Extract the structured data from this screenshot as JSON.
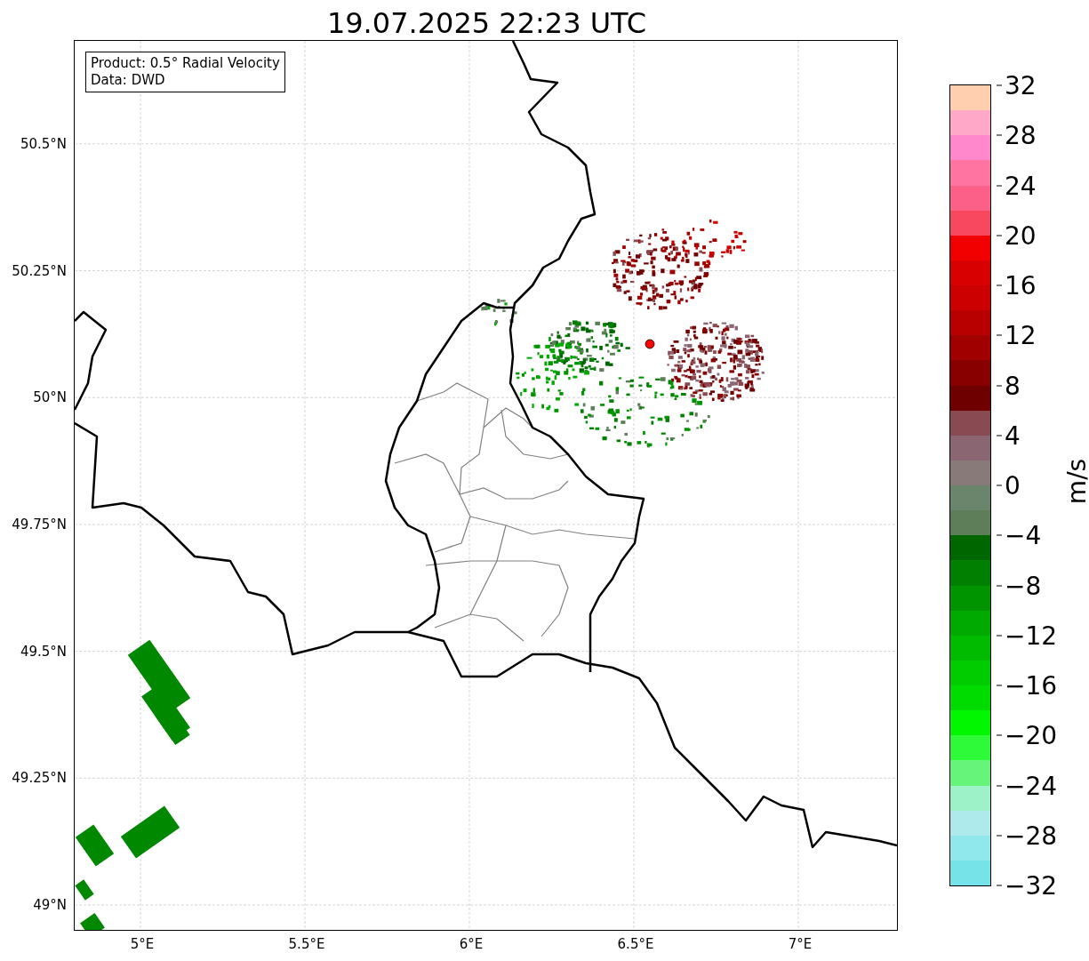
{
  "title": "19.07.2025 22:23 UTC",
  "map": {
    "info": [
      "Product: 0.5° Radial Velocity",
      "Data: DWD"
    ],
    "lon_ticks": [
      "5°E",
      "5.5°E",
      "6°E",
      "6.5°E",
      "7°E"
    ],
    "lat_ticks": [
      "50.5°N",
      "50.25°N",
      "50°N",
      "49.75°N",
      "49.5°N",
      "49.25°N",
      "49°N"
    ]
  },
  "colorbar": {
    "label": "m/s",
    "ticks": [
      "32",
      "28",
      "24",
      "20",
      "16",
      "12",
      "8",
      "4",
      "0",
      "−4",
      "−8",
      "−12",
      "−16",
      "−20",
      "−24",
      "−28",
      "−32"
    ],
    "bins": [
      {
        "color": "#76e3e8"
      },
      {
        "color": "#90e8ec"
      },
      {
        "color": "#aeeaec"
      },
      {
        "color": "#9df2c8"
      },
      {
        "color": "#66f57a"
      },
      {
        "color": "#2ffa3a"
      },
      {
        "color": "#00f700"
      },
      {
        "color": "#00dc00"
      },
      {
        "color": "#00cc00"
      },
      {
        "color": "#00bb00"
      },
      {
        "color": "#00aa00"
      },
      {
        "color": "#009400"
      },
      {
        "color": "#007f00"
      },
      {
        "color": "#006600"
      },
      {
        "color": "#5e7e5a"
      },
      {
        "color": "#6b846c"
      },
      {
        "color": "#887a78"
      },
      {
        "color": "#8a6672"
      },
      {
        "color": "#8a4a52"
      },
      {
        "color": "#6e0000"
      },
      {
        "color": "#880000"
      },
      {
        "color": "#a00000"
      },
      {
        "color": "#b80000"
      },
      {
        "color": "#cc0000"
      },
      {
        "color": "#d80000"
      },
      {
        "color": "#f20000"
      },
      {
        "color": "#f84860"
      },
      {
        "color": "#fc6088"
      },
      {
        "color": "#ff74a0"
      },
      {
        "color": "#ff88cc"
      },
      {
        "color": "#ffa8c8"
      },
      {
        "color": "#ffcfb0"
      }
    ]
  }
}
